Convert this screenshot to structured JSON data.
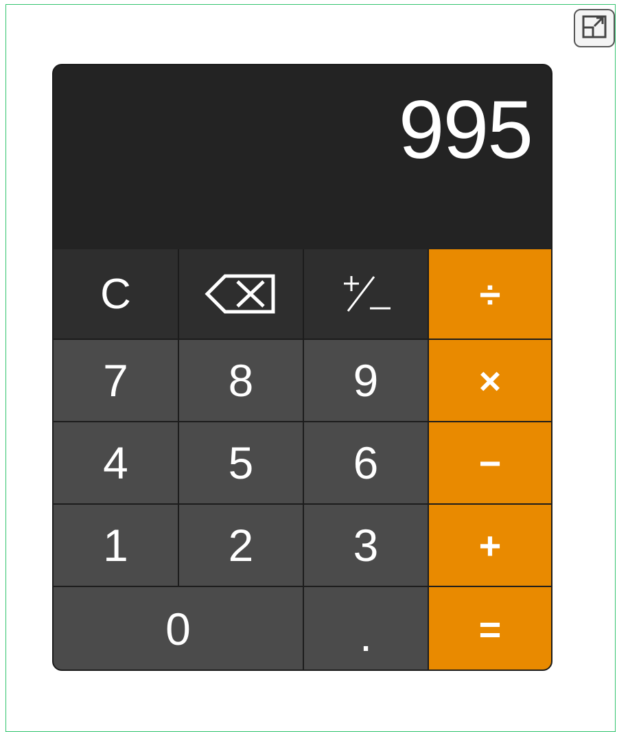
{
  "window": {
    "expand_icon": "expand-icon"
  },
  "display": {
    "value": "995"
  },
  "keys": {
    "clear": "C",
    "backspace_icon": "backspace-icon",
    "sign_icon": "plus-minus-icon",
    "divide": "÷",
    "seven": "7",
    "eight": "8",
    "nine": "9",
    "multiply": "×",
    "four": "4",
    "five": "5",
    "six": "6",
    "subtract": "−",
    "one": "1",
    "two": "2",
    "three": "3",
    "add": "+",
    "zero": "0",
    "decimal": ".",
    "equals": "="
  },
  "colors": {
    "operator": "#e98a00",
    "number_key": "#4b4b4b",
    "function_key": "#2e2e2e",
    "display_bg": "#232323",
    "frame_border": "#32c46e"
  }
}
